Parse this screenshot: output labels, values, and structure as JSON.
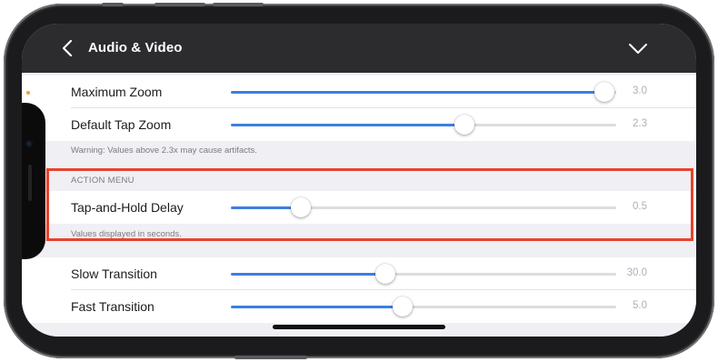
{
  "nav": {
    "title": "Audio & Video"
  },
  "rows": [
    {
      "label": "Maximum Zoom",
      "value": "3.0",
      "fraction": 0.97
    },
    {
      "label": "Default Tap Zoom",
      "value": "2.3",
      "fraction": 0.607
    },
    {
      "label": "Tap-and-Hold Delay",
      "value": "0.5",
      "fraction": 0.181
    },
    {
      "label": "Slow Transition",
      "value": "30.0",
      "fraction": 0.401
    },
    {
      "label": "Fast Transition",
      "value": "5.0",
      "fraction": 0.446
    }
  ],
  "footers": {
    "zoom_warning": "Warning: Values above 2.3x may cause artifacts.",
    "seconds_note": "Values displayed in seconds."
  },
  "section_headers": {
    "action_menu": "ACTION MENU"
  },
  "colors": {
    "accent": "#3d7fe0",
    "highlight": "#e8432c",
    "navbar": "#2c2c2e",
    "indicator": "#f0a030"
  },
  "icons": {
    "back": "chevron-left-icon",
    "collapse": "chevron-down-icon"
  }
}
